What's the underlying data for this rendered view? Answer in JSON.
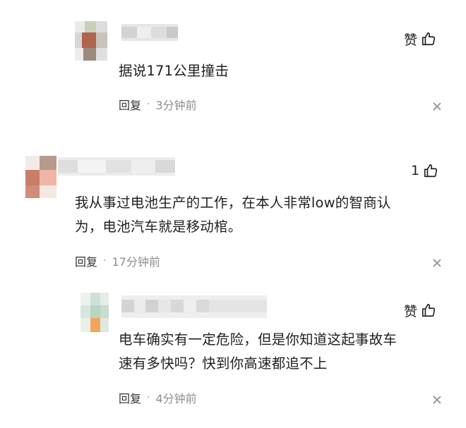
{
  "comments": [
    {
      "text_lines": [
        "据说171公里撞击"
      ],
      "like_label": "赞",
      "like_icon": "thumbs-up-icon",
      "reply_label": "回复",
      "separator": "·",
      "time": "3分钟前",
      "close_icon": "close-icon"
    },
    {
      "text_lines": [
        "我从事过电池生产的工作，在本人非常low的智商认",
        "为，电池汽车就是移动棺。"
      ],
      "like_label": "1",
      "like_icon": "thumbs-up-icon",
      "reply_label": "回复",
      "separator": "·",
      "time": "17分钟前",
      "close_icon": "close-icon"
    },
    {
      "text_lines": [
        "电车确实有一定危险，但是你知道这起事故车",
        "速有多快吗？快到你高速都追不上"
      ],
      "like_label": "赞",
      "like_icon": "thumbs-up-icon",
      "reply_label": "回复",
      "separator": "·",
      "time": "4分钟前",
      "close_icon": "close-icon"
    }
  ]
}
